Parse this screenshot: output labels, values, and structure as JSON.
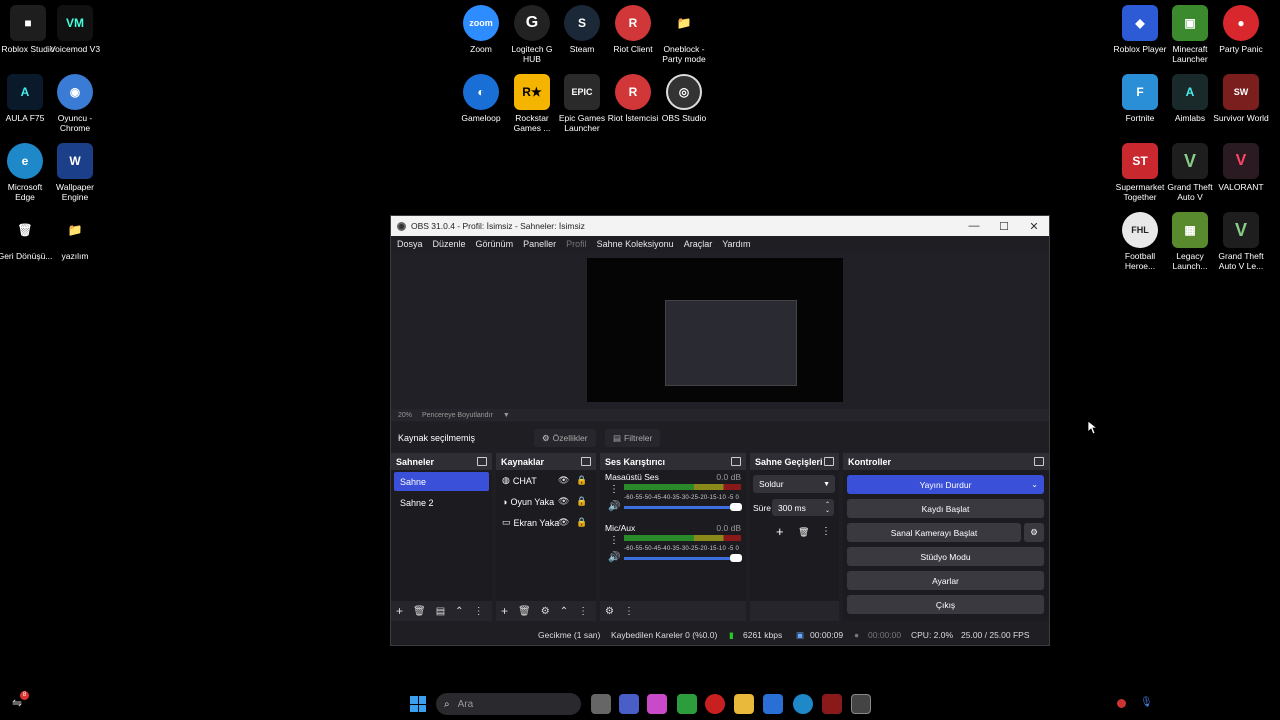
{
  "desktop": {
    "icons": [
      {
        "label": "Roblox Studio",
        "color": "#1e1e1e",
        "glyph": "■"
      },
      {
        "label": "Voicemod V3",
        "color": "#111111",
        "glyph": "VM"
      },
      {
        "label": "AULA F75",
        "color": "#0a1a2a",
        "glyph": "A"
      },
      {
        "label": "Oyuncu - Chrome",
        "color": "#3a7bd5",
        "glyph": "◉"
      },
      {
        "label": "Microsoft Edge",
        "color": "#1e88c9",
        "glyph": "e"
      },
      {
        "label": "Wallpaper Engine",
        "color": "#1c3f8a",
        "glyph": "W"
      },
      {
        "label": "Geri Dönüşü...",
        "color": "#5b7a99",
        "glyph": "🗑"
      },
      {
        "label": "yazılım",
        "color": "#e6c04a",
        "glyph": "📁"
      },
      {
        "label": "Zoom",
        "color": "#2d8cff",
        "glyph": "zoom"
      },
      {
        "label": "Logitech G HUB",
        "color": "#222222",
        "glyph": "G"
      },
      {
        "label": "Steam",
        "color": "#1b2838",
        "glyph": "S"
      },
      {
        "label": "Riot Client",
        "color": "#d13639",
        "glyph": "R"
      },
      {
        "label": "Oneblock - Party mode",
        "color": "#e8b93a",
        "glyph": "📁"
      },
      {
        "label": "Gameloop",
        "color": "#1a6fd6",
        "glyph": "◐"
      },
      {
        "label": "Rockstar Games ...",
        "color": "#f5b400",
        "glyph": "R★"
      },
      {
        "label": "Epic Games Launcher",
        "color": "#2a2a2a",
        "glyph": "EPIC"
      },
      {
        "label": "Riot İstemcisi",
        "color": "#d13639",
        "glyph": "R"
      },
      {
        "label": "OBS Studio",
        "color": "#333333",
        "glyph": "◎"
      },
      {
        "label": "Roblox Player",
        "color": "#2d5bd6",
        "glyph": "◆"
      },
      {
        "label": "Minecraft Launcher",
        "color": "#3c8a2e",
        "glyph": "▣"
      },
      {
        "label": "Party Panic",
        "color": "#d8282e",
        "glyph": "●"
      },
      {
        "label": "Fortnite",
        "color": "#2a8fd6",
        "glyph": "F"
      },
      {
        "label": "Aimlabs",
        "color": "#1a2a2a",
        "glyph": "A"
      },
      {
        "label": "Survivor World",
        "color": "#7a1e1e",
        "glyph": "SW"
      },
      {
        "label": "Supermarket Together",
        "color": "#c8282e",
        "glyph": "ST"
      },
      {
        "label": "Grand Theft Auto V",
        "color": "#1e1e1e",
        "glyph": "V"
      },
      {
        "label": "VALORANT",
        "color": "#2a1a22",
        "glyph": "V"
      },
      {
        "label": "Football Heroe...",
        "color": "#e8e8e8",
        "glyph": "FHL"
      },
      {
        "label": "Legacy Launch...",
        "color": "#5a8a2e",
        "glyph": "▦"
      },
      {
        "label": "Grand Theft Auto V Le...",
        "color": "#1e1e1e",
        "glyph": "V"
      }
    ]
  },
  "obs": {
    "title": "OBS 31.0.4 - Profil: İsimsiz - Sahneler: İsimsiz",
    "menu": [
      "Dosya",
      "Düzenle",
      "Görünüm",
      "Paneller",
      "Profil",
      "Sahne Koleksiyonu",
      "Araçlar",
      "Yardım"
    ],
    "zoom": "20%",
    "zoom_mode": "Pencereye Boyutlandır",
    "no_source": "Kaynak seçilmemiş",
    "properties": "Özellikler",
    "filters": "Filtreler",
    "scenes": {
      "title": "Sahneler",
      "items": [
        "Sahne",
        "Sahne 2"
      ]
    },
    "sources": {
      "title": "Kaynaklar",
      "items": [
        "CHAT",
        "Oyun Yaka",
        "Ekran Yaka"
      ]
    },
    "mixer": {
      "title": "Ses Karıştırıcı",
      "channels": [
        {
          "name": "Masaüstü Ses",
          "db": "0.0 dB"
        },
        {
          "name": "Mic/Aux",
          "db": "0.0 dB"
        }
      ],
      "scale": "-60-55-50-45-40-35-30-25-20-15-10 -5  0"
    },
    "transitions": {
      "title": "Sahne Geçişleri",
      "type": "Soldur",
      "duration_label": "Süre",
      "duration": "300 ms"
    },
    "controls": {
      "title": "Kontroller",
      "stop_stream": "Yayını Durdur",
      "start_record": "Kaydı Başlat",
      "virtual_cam": "Sanal Kamerayı Başlat",
      "studio_mode": "Stüdyo Modu",
      "settings": "Ayarlar",
      "exit": "Çıkış"
    },
    "status": {
      "delay": "Gecikme (1 san)",
      "dropped": "Kaybedilen Kareler 0 (%0.0)",
      "bitrate": "6261 kbps",
      "stream_time": "00:00:09",
      "rec_time": "00:00:00",
      "cpu": "CPU: 2.0%",
      "fps": "25.00 / 25.00 FPS"
    }
  },
  "taskbar": {
    "search_placeholder": "Ara",
    "notification_count": "8"
  }
}
